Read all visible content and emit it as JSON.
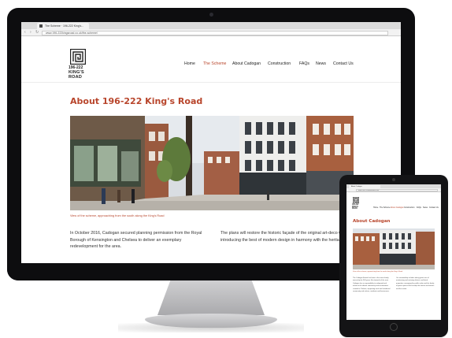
{
  "browser": {
    "tab_title": "The Scheme · 196-222 King's...",
    "url": "www.196-222kingsroad.co.uk/the-scheme/"
  },
  "site": {
    "logo_line1": "196-222",
    "logo_line2": "KING'S",
    "logo_line3": "ROAD",
    "nav": [
      "Home",
      "The Scheme",
      "About Cadogan",
      "Construction",
      "FAQs",
      "News",
      "Contact Us"
    ],
    "active_nav": "The Scheme",
    "page_title": "About 196-222 King's Road",
    "hero_caption": "View of the scheme, approaching from the south along the King's Road",
    "para_left": "In October 2016, Cadogan secured planning permission from the Royal Borough of Kensington and Chelsea to deliver an exemplary redevelopment for the area.",
    "para_right": "The plans will restore the historic façade of the original art-deco Gaumont Palace building, introducing the best of modern design in harmony with the heritage surroundings."
  },
  "tablet": {
    "tab_title": "About Cadogan",
    "url": "www.196-222kingsroad.co.uk",
    "nav": [
      "Home",
      "The Scheme",
      "About Cadogan",
      "Construction",
      "FAQs",
      "News",
      "Contact Us"
    ],
    "active_nav": "About Cadogan",
    "page_title": "About Cadogan",
    "hero_caption": "View of the scheme, approaching from the south along the King's Road",
    "para_left": "The Cadogan Estate has been in the same family ownership for 300 years. As stewards of the area Cadogan has a responsibility to safeguard and enhance the vibrant community and environment created in Chelsea, supporting retail and residential community and visitors, residents and businesses.",
    "para_right": "Our stewardship includes taking great care of maintaining and restoring historic and listed properties, managing the public realm and the family of green spaces that envelop the houses and streets and the estate."
  },
  "colors": {
    "accent": "#b8452b",
    "bezel": "#0d0d0f"
  }
}
